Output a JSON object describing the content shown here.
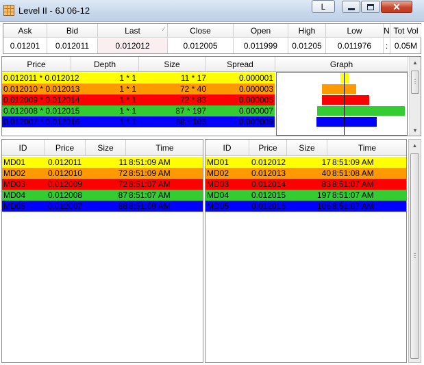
{
  "window": {
    "title": "Level II - 6J 06-12",
    "l_button_label": "L",
    "icons": {
      "app": "grid-icon",
      "minimize": "minimize-icon",
      "maximize": "maximize-icon",
      "close": "close-icon"
    }
  },
  "quote": {
    "headers": [
      "Ask",
      "Bid",
      "Last",
      "Close",
      "Open",
      "High",
      "Low",
      "N",
      "Tot Vol"
    ],
    "values": [
      "0.01201",
      "0.012011",
      "0.012012",
      "0.012005",
      "0.011999",
      "0.01205",
      "0.011976",
      ":",
      "0.05M"
    ]
  },
  "depth": {
    "headers": [
      "Price",
      "Depth",
      "Size",
      "Spread",
      "Graph"
    ],
    "rows": [
      {
        "price": "0.012011 * 0.012012",
        "depth": "1 * 1",
        "size": "11 * 17",
        "spread": "0.000001",
        "bg": "#ffff00",
        "fg": "#000000"
      },
      {
        "price": "0.012010 * 0.012013",
        "depth": "1 * 1",
        "size": "72 * 40",
        "spread": "0.000003",
        "bg": "#ff9900",
        "fg": "#000000"
      },
      {
        "price": "0.012009 * 0.012014",
        "depth": "1 * 1",
        "size": "72 * 83",
        "spread": "0.000005",
        "bg": "#ff0000",
        "fg": "#000000"
      },
      {
        "price": "0.012008 * 0.012015",
        "depth": "1 * 1",
        "size": "87 * 197",
        "spread": "0.000007",
        "bg": "#33cc33",
        "fg": "#000000"
      },
      {
        "price": "0.012007 * 0.012016",
        "depth": "1 * 1",
        "size": "88 * 106",
        "spread": "0.000009",
        "bg": "#0000ff",
        "fg": "#000000"
      }
    ],
    "graph": {
      "levels": [
        {
          "bid_size": 11,
          "ask_size": 17,
          "color": "#ffff00"
        },
        {
          "bid_size": 72,
          "ask_size": 40,
          "color": "#ff9900"
        },
        {
          "bid_size": 72,
          "ask_size": 83,
          "color": "#ff0000"
        },
        {
          "bid_size": 87,
          "ask_size": 197,
          "color": "#33cc33"
        },
        {
          "bid_size": 88,
          "ask_size": 106,
          "color": "#0000ff"
        }
      ]
    }
  },
  "bids": {
    "headers": [
      "ID",
      "Price",
      "Size",
      "Time"
    ],
    "rows": [
      {
        "id": "MD01",
        "price": "0.012011",
        "size": "11",
        "time": "8:51:09 AM",
        "bg": "#ffff00"
      },
      {
        "id": "MD02",
        "price": "0.012010",
        "size": "72",
        "time": "8:51:09 AM",
        "bg": "#ff9900"
      },
      {
        "id": "MD03",
        "price": "0.012009",
        "size": "72",
        "time": "8:51:07 AM",
        "bg": "#ff0000"
      },
      {
        "id": "MD04",
        "price": "0.012008",
        "size": "87",
        "time": "8:51:07 AM",
        "bg": "#33cc33"
      },
      {
        "id": "MD05",
        "price": "0.012007",
        "size": "88",
        "time": "8:51:09 AM",
        "bg": "#0000ff"
      }
    ]
  },
  "asks": {
    "headers": [
      "ID",
      "Price",
      "Size",
      "Time"
    ],
    "rows": [
      {
        "id": "MD01",
        "price": "0.012012",
        "size": "17",
        "time": "8:51:09 AM",
        "bg": "#ffff00"
      },
      {
        "id": "MD02",
        "price": "0.012013",
        "size": "40",
        "time": "8:51:08 AM",
        "bg": "#ff9900"
      },
      {
        "id": "MD03",
        "price": "0.012014",
        "size": "83",
        "time": "8:51:07 AM",
        "bg": "#ff0000"
      },
      {
        "id": "MD04",
        "price": "0.012015",
        "size": "197",
        "time": "8:51:07 AM",
        "bg": "#33cc33"
      },
      {
        "id": "MD05",
        "price": "0.012016",
        "size": "106",
        "time": "8:51:07 AM",
        "bg": "#0000ff"
      }
    ]
  }
}
